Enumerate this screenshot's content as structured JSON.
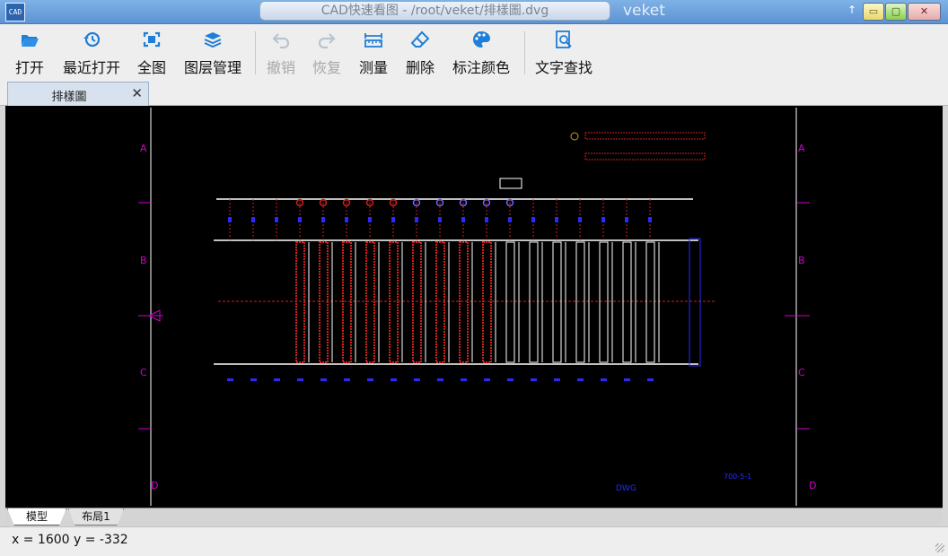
{
  "window": {
    "app_icon_text": "CAD",
    "title": "CAD快速看图 - /root/veket/排樣圖.dvg",
    "brand": "veket",
    "controls": {
      "up": "↑",
      "minimize": "▭",
      "maximize": "▢",
      "close": "✕"
    }
  },
  "toolbar": {
    "items": [
      {
        "label": "打开",
        "icon": "folder-open-icon",
        "enabled": true
      },
      {
        "label": "最近打开",
        "icon": "history-icon",
        "enabled": true
      },
      {
        "label": "全图",
        "icon": "fit-view-icon",
        "enabled": true
      },
      {
        "label": "图层管理",
        "icon": "layers-icon",
        "enabled": true
      },
      {
        "label": "撤销",
        "icon": "undo-icon",
        "enabled": false
      },
      {
        "label": "恢复",
        "icon": "redo-icon",
        "enabled": false
      },
      {
        "label": "测量",
        "icon": "ruler-icon",
        "enabled": true
      },
      {
        "label": "删除",
        "icon": "eraser-icon",
        "enabled": true
      },
      {
        "label": "标注颜色",
        "icon": "palette-icon",
        "enabled": true
      },
      {
        "label": "文字查找",
        "icon": "text-search-icon",
        "enabled": true
      }
    ]
  },
  "document_tab": {
    "label": "排樣圖",
    "close": "✕"
  },
  "drawing": {
    "row_markers": [
      "A",
      "B",
      "C",
      "D"
    ],
    "stamp_text": "700-5-1",
    "bottom_label": "DWG"
  },
  "layout_tabs": {
    "active": "模型",
    "inactive": "布局1"
  },
  "status": {
    "coords": "x = 1600 y = -332"
  },
  "colors": {
    "icon_blue": "#1e7fd8",
    "icon_disabled": "#b8c4d0",
    "cad_magenta": "#d000d0",
    "cad_red": "#d02020",
    "cad_blue": "#2a2aff",
    "cad_white": "#ffffff"
  }
}
